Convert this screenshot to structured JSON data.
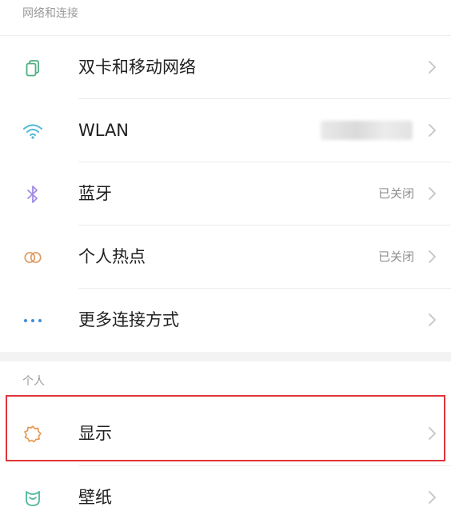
{
  "sections": {
    "network_title": "网络和连接",
    "personal_title": "个人"
  },
  "items": {
    "dual_sim": {
      "label": "双卡和移动网络",
      "icon": "dual-sim-icon"
    },
    "wlan": {
      "label": "WLAN",
      "icon": "wifi-icon"
    },
    "bluetooth": {
      "label": "蓝牙",
      "value": "已关闭",
      "icon": "bluetooth-icon"
    },
    "hotspot": {
      "label": "个人热点",
      "value": "已关闭",
      "icon": "hotspot-icon"
    },
    "more_connections": {
      "label": "更多连接方式",
      "icon": "more-dots-icon"
    },
    "display": {
      "label": "显示",
      "icon": "display-brightness-icon"
    },
    "wallpaper": {
      "label": "壁纸",
      "icon": "wallpaper-icon"
    }
  },
  "colors": {
    "highlight_border": "#e0353a",
    "wifi_icon": "#4cb8d6",
    "dual_sim_icon": "#4caf82",
    "bluetooth_icon": "#a28be3",
    "hotspot_icon": "#e09a62",
    "more_icon": "#3f8fd6",
    "display_icon": "#e39a55",
    "wallpaper_icon": "#4cb89b"
  }
}
